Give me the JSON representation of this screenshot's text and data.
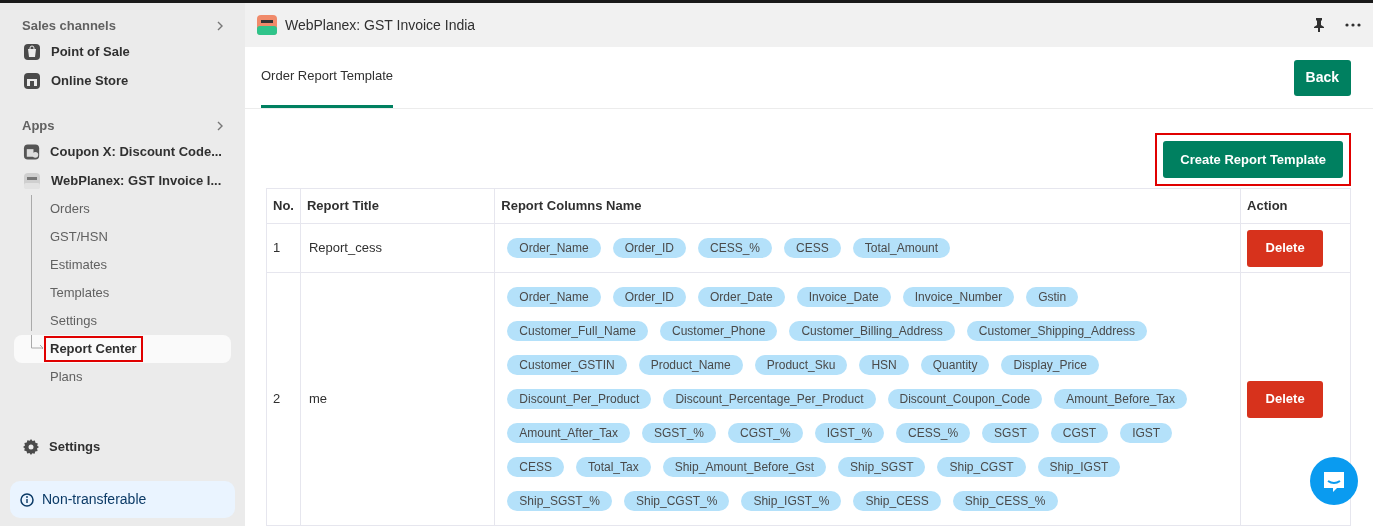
{
  "sidebar": {
    "sections": [
      {
        "title": "Sales channels",
        "items": [
          {
            "label": "Point of Sale"
          },
          {
            "label": "Online Store"
          }
        ]
      },
      {
        "title": "Apps",
        "items": [
          {
            "label": "Coupon X: Discount Code..."
          },
          {
            "label": "WebPlanex: GST Invoice I...",
            "children": [
              {
                "label": "Orders",
                "selected": false
              },
              {
                "label": "GST/HSN",
                "selected": false
              },
              {
                "label": "Estimates",
                "selected": false
              },
              {
                "label": "Templates",
                "selected": false
              },
              {
                "label": "Settings",
                "selected": false
              },
              {
                "label": "Report Center",
                "selected": true
              },
              {
                "label": "Plans",
                "selected": false
              }
            ]
          }
        ]
      }
    ],
    "settings": "Settings",
    "notice": "Non-transferable"
  },
  "app_header": {
    "title": "WebPlanex: GST Invoice India"
  },
  "tabs": [
    {
      "label": "Order Report Template",
      "selected": true
    }
  ],
  "back_button": "Back",
  "create_button": "Create Report Template",
  "table": {
    "columns": [
      "No.",
      "Report Title",
      "Report Columns Name",
      "Action"
    ],
    "rows": [
      {
        "no": "1",
        "title": "Report_cess",
        "columns": [
          "Order_Name",
          "Order_ID",
          "CESS_%",
          "CESS",
          "Total_Amount"
        ],
        "action": "Delete"
      },
      {
        "no": "2",
        "title": "me",
        "columns": [
          "Order_Name",
          "Order_ID",
          "Order_Date",
          "Invoice_Date",
          "Invoice_Number",
          "Gstin",
          "Customer_Full_Name",
          "Customer_Phone",
          "Customer_Billing_Address",
          "Customer_Shipping_Address",
          "Customer_GSTIN",
          "Product_Name",
          "Product_Sku",
          "HSN",
          "Quantity",
          "Display_Price",
          "Discount_Per_Product",
          "Discount_Percentage_Per_Product",
          "Discount_Coupon_Code",
          "Amount_Before_Tax",
          "Amount_After_Tax",
          "SGST_%",
          "CGST_%",
          "IGST_%",
          "CESS_%",
          "SGST",
          "CGST",
          "IGST",
          "CESS",
          "Total_Tax",
          "Ship_Amount_Before_Gst",
          "Ship_SGST",
          "Ship_CGST",
          "Ship_IGST",
          "Ship_SGST_%",
          "Ship_CGST_%",
          "Ship_IGST_%",
          "Ship_CESS",
          "Ship_CESS_%"
        ],
        "action": "Delete"
      }
    ]
  }
}
